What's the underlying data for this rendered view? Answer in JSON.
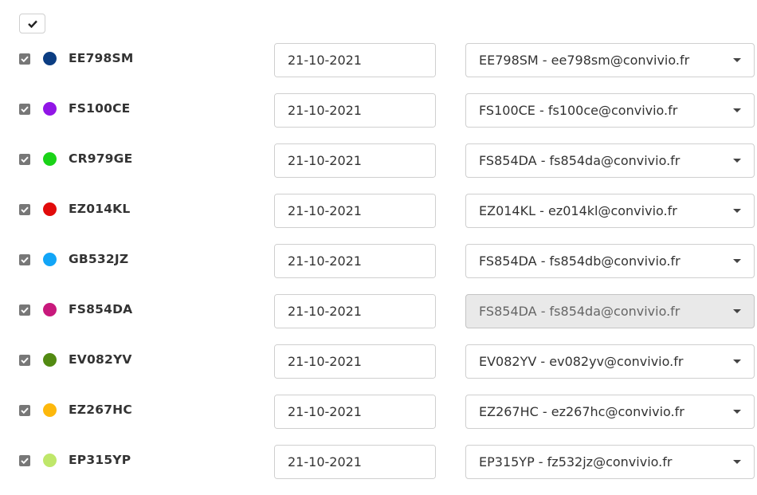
{
  "select_all": {
    "checked": true
  },
  "rows": [
    {
      "code": "EE798SM",
      "color": "#0b3d82",
      "date": "21-10-2021",
      "recipient": "EE798SM - ee798sm@convivio.fr",
      "disabled": false
    },
    {
      "code": "FS100CE",
      "color": "#9116e6",
      "date": "21-10-2021",
      "recipient": "FS100CE - fs100ce@convivio.fr",
      "disabled": false
    },
    {
      "code": "CR979GE",
      "color": "#1ad318",
      "date": "21-10-2021",
      "recipient": "FS854DA - fs854da@convivio.fr",
      "disabled": false
    },
    {
      "code": "EZ014KL",
      "color": "#e10b0b",
      "date": "21-10-2021",
      "recipient": "EZ014KL - ez014kl@convivio.fr",
      "disabled": false
    },
    {
      "code": "GB532JZ",
      "color": "#12a5f7",
      "date": "21-10-2021",
      "recipient": "FS854DA - fs854db@convivio.fr",
      "disabled": false
    },
    {
      "code": "FS854DA",
      "color": "#c8197c",
      "date": "21-10-2021",
      "recipient": "FS854DA - fs854da@convivio.fr",
      "disabled": true
    },
    {
      "code": "EV082YV",
      "color": "#528a12",
      "date": "21-10-2021",
      "recipient": "EV082YV - ev082yv@convivio.fr",
      "disabled": false
    },
    {
      "code": "EZ267HC",
      "color": "#fdb80c",
      "date": "21-10-2021",
      "recipient": "EZ267HC - ez267hc@convivio.fr",
      "disabled": false
    },
    {
      "code": "EP315YP",
      "color": "#bfe76a",
      "date": "21-10-2021",
      "recipient": "EP315YP - fz532jz@convivio.fr",
      "disabled": false
    }
  ],
  "icons": {
    "checkmark": "check-icon",
    "calendar": "calendar-icon",
    "dropdown": "caret-down-icon"
  }
}
